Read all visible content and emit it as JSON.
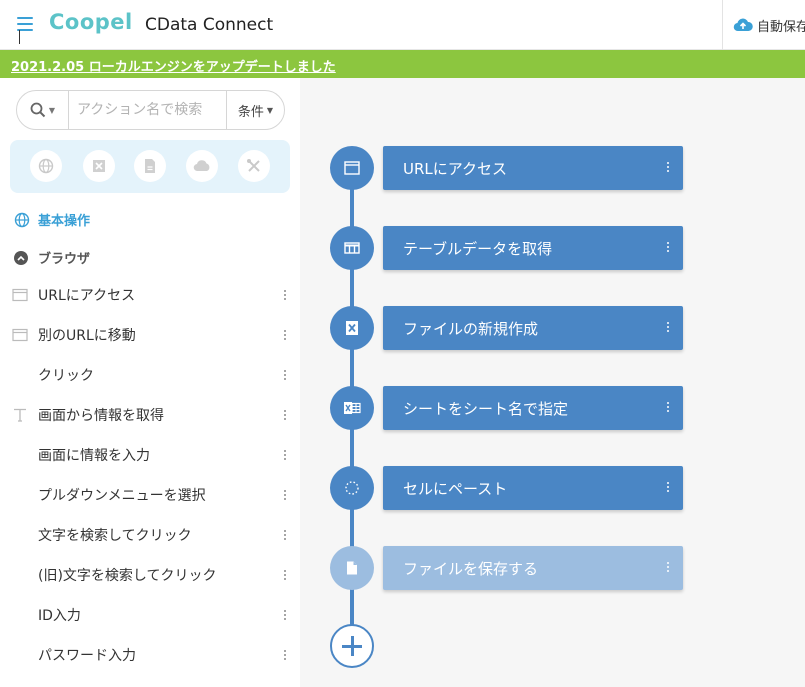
{
  "header": {
    "logo": "Coopel",
    "title": "CData Connect",
    "autosave_label": "自動保存"
  },
  "banner": {
    "text": "2021.2.05 ローカルエンジンをアップデートしました"
  },
  "sidebar": {
    "search": {
      "placeholder": "アクション名で検索",
      "value": ""
    },
    "condition_label": "条件",
    "categories": [
      "globe-icon",
      "excel-icon",
      "file-icon",
      "cloud-icon",
      "tools-icon"
    ],
    "section_label": "基本操作",
    "group_label": "ブラウザ",
    "actions": [
      {
        "label": "URLにアクセス",
        "icon": "browser-window-icon"
      },
      {
        "label": "別のURLに移動",
        "icon": "browser-window-icon"
      },
      {
        "label": "クリック",
        "icon": ""
      },
      {
        "label": "画面から情報を取得",
        "icon": "text-icon"
      },
      {
        "label": "画面に情報を入力",
        "icon": ""
      },
      {
        "label": "プルダウンメニューを選択",
        "icon": ""
      },
      {
        "label": "文字を検索してクリック",
        "icon": ""
      },
      {
        "label": "(旧)文字を検索してクリック",
        "icon": ""
      },
      {
        "label": "ID入力",
        "icon": ""
      },
      {
        "label": "パスワード入力",
        "icon": ""
      }
    ]
  },
  "flow": {
    "steps": [
      {
        "label": "URLにアクセス",
        "icon": "browser-window-icon",
        "enabled": true
      },
      {
        "label": "テーブルデータを取得",
        "icon": "table-icon",
        "enabled": true
      },
      {
        "label": "ファイルの新規作成",
        "icon": "excel-icon",
        "enabled": true
      },
      {
        "label": "シートをシート名で指定",
        "icon": "sheet-icon",
        "enabled": true
      },
      {
        "label": "セルにペースト",
        "icon": "dotted-circle-icon",
        "enabled": true
      },
      {
        "label": "ファイルを保存する",
        "icon": "file-icon",
        "enabled": false
      }
    ]
  },
  "colors": {
    "accent": "#3aa0d6",
    "banner": "#8cc63f",
    "step": "#4a86c5",
    "step_disabled": "#9cbde0"
  }
}
